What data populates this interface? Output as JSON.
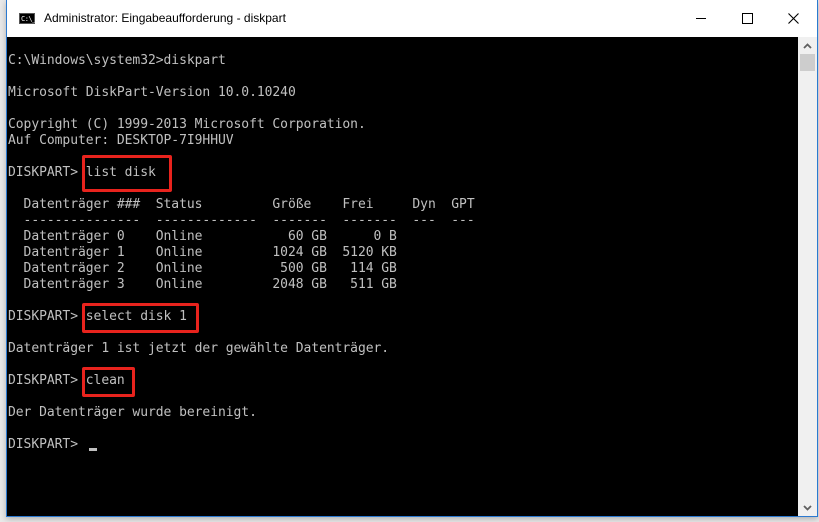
{
  "window": {
    "title": "Administrator: Eingabeaufforderung - diskpart",
    "icon": "cmd-icon",
    "icon_text": "C:\\_",
    "controls": {
      "minimize": "minimize-icon",
      "maximize": "maximize-icon",
      "close": "close-icon"
    }
  },
  "console": {
    "lines": [
      "C:\\Windows\\system32>diskpart",
      "",
      "Microsoft DiskPart-Version 10.0.10240",
      "",
      "Copyright (C) 1999-2013 Microsoft Corporation.",
      "Auf Computer: DESKTOP-7I9HHUV",
      "",
      "DISKPART> list disk",
      "",
      "  Datenträger ###  Status         Größe    Frei     Dyn  GPT",
      "  ---------------  -------------  -------  -------  ---  ---",
      "  Datenträger 0    Online           60 GB      0 B",
      "  Datenträger 1    Online         1024 GB  5120 KB",
      "  Datenträger 2    Online          500 GB   114 GB",
      "  Datenträger 3    Online         2048 GB   511 GB",
      "",
      "DISKPART> select disk 1",
      "",
      "Datenträger 1 ist jetzt der gewählte Datenträger.",
      "",
      "DISKPART> clean",
      "",
      "Der Datenträger wurde bereinigt.",
      "",
      "DISKPART> "
    ],
    "highlighted_commands": [
      "list disk",
      "select disk 1",
      "clean"
    ],
    "highlight_color": "#e8231d",
    "text_color": "#c0c0c0",
    "background_color": "#000000"
  },
  "disk_table": {
    "columns": [
      "Datenträger ###",
      "Status",
      "Größe",
      "Frei",
      "Dyn",
      "GPT"
    ],
    "rows": [
      [
        "Datenträger 0",
        "Online",
        "60 GB",
        "0 B",
        "",
        ""
      ],
      [
        "Datenträger 1",
        "Online",
        "1024 GB",
        "5120 KB",
        "",
        ""
      ],
      [
        "Datenträger 2",
        "Online",
        "500 GB",
        "114 GB",
        "",
        ""
      ],
      [
        "Datenträger 3",
        "Online",
        "2048 GB",
        "511 GB",
        "",
        ""
      ]
    ]
  },
  "scrollbar": {
    "up": "chevron-up-icon",
    "down": "chevron-down-icon",
    "up_glyph": "⌃",
    "down_glyph": "⌄"
  }
}
